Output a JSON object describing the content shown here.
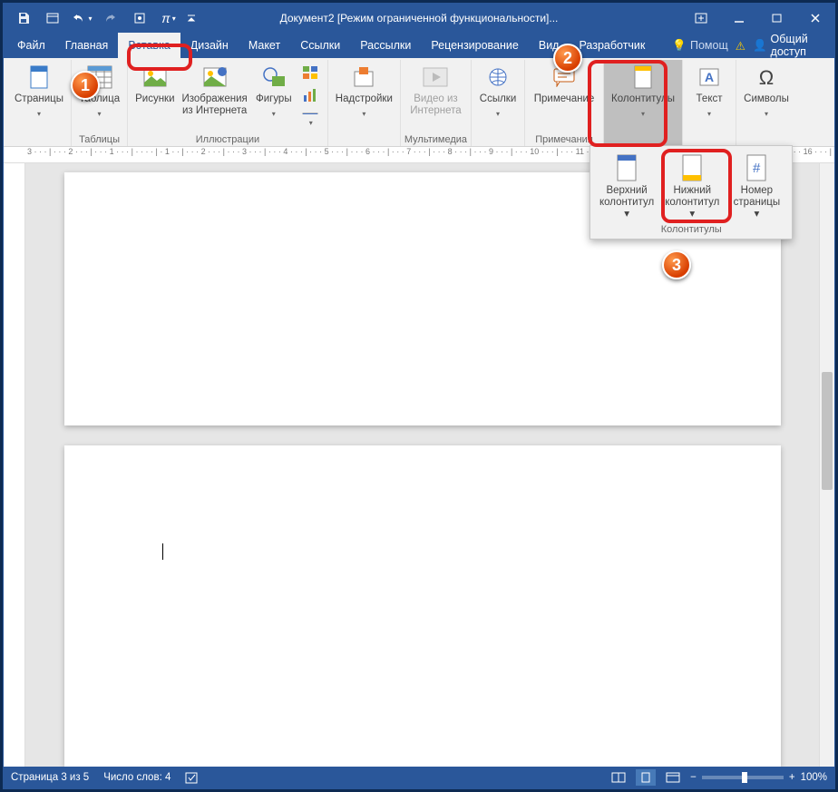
{
  "titlebar": {
    "title": "Документ2 [Режим ограниченной функциональности]..."
  },
  "menu": {
    "file": "Файл",
    "home": "Главная",
    "insert": "Вставка",
    "design": "Дизайн",
    "layout": "Макет",
    "references": "Ссылки",
    "mailings": "Рассылки",
    "review": "Рецензирование",
    "view": "Вид",
    "developer": "Разработчик",
    "help": "Помощ",
    "share": "Общий доступ"
  },
  "ribbon": {
    "pages": {
      "label": "Страницы",
      "group": ""
    },
    "tables": {
      "label": "Таблица",
      "group": "Таблицы"
    },
    "illustrations": {
      "pictures": "Рисунки",
      "online": "Изображения\nиз Интернета",
      "shapes": "Фигуры",
      "group": "Иллюстрации"
    },
    "addins": {
      "label": "Надстройки"
    },
    "media": {
      "video": "Видео из\nИнтернета",
      "group": "Мультимедиа"
    },
    "links": {
      "label": "Ссылки"
    },
    "comments": {
      "label": "Примечание",
      "group": "Примечания"
    },
    "headers": {
      "label": "Колонтитулы"
    },
    "text": {
      "label": "Текст"
    },
    "symbols": {
      "label": "Символы"
    }
  },
  "dropdown": {
    "header": "Верхний\nколонтитул",
    "footer": "Нижний\nколонтитул",
    "pagenum": "Номер\nстраницы",
    "group": "Колонтитулы"
  },
  "status": {
    "page": "Страница 3 из 5",
    "words": "Число слов: 4",
    "zoom": "100%"
  },
  "ruler": "3 · · · | · · · 2 · · · | · · · 1 · · · | · · ·   · | · 1 · · | · · · 2 · · · | · · · 3 · · · | · · · 4 · · · | · · · 5 · · · | · · · 6 · · · | · · · 7 · · · | · · · 8 · · · | · · · 9 · · · | · · · 10 · · · | · · · 11 · · · | · · · 12 · · · | · · · 13 · · · | · · · 14 · · · | · · · 15 · · · | · · · 16 · · · | · · ·    · | · · · 1"
}
